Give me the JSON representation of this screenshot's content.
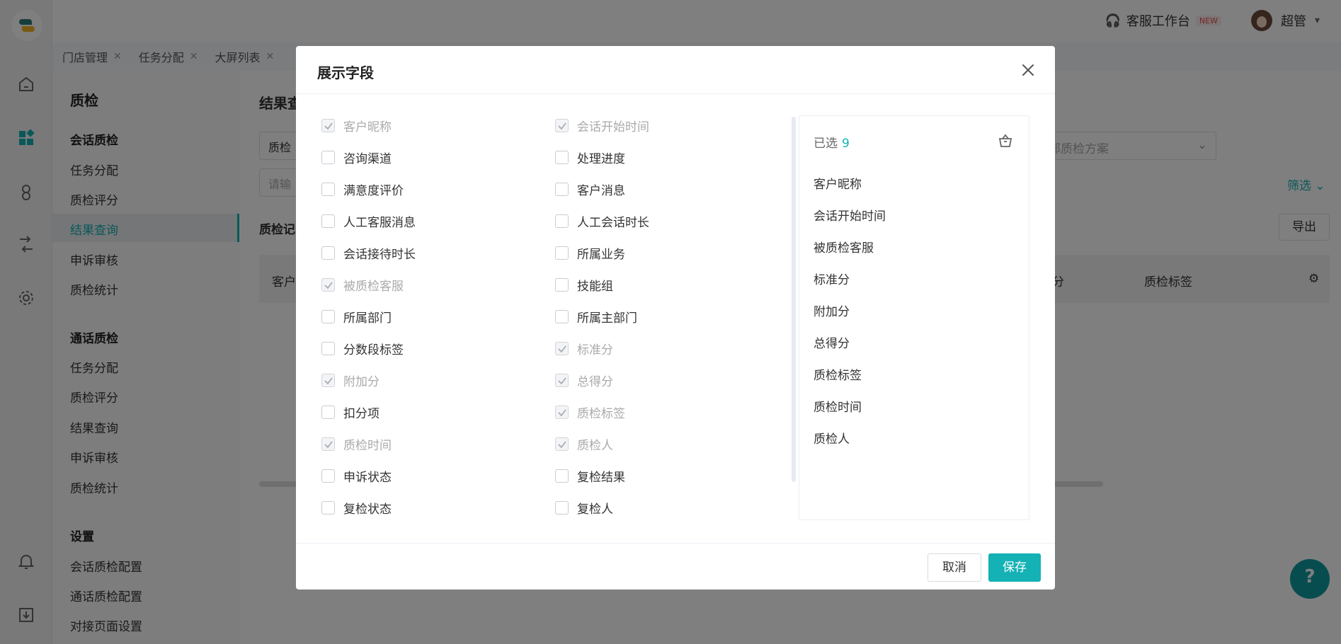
{
  "topbar": {
    "workspace_label": "客服工作台",
    "workspace_badge": "NEW",
    "user_name": "超管"
  },
  "tabs": [
    {
      "label": "门店管理"
    },
    {
      "label": "任务分配"
    },
    {
      "label": "大屏列表"
    }
  ],
  "sidenav": {
    "title": "质检",
    "groups": [
      {
        "heading": "会话质检",
        "items": [
          "任务分配",
          "质检评分",
          "结果查询",
          "申诉审核",
          "质检统计"
        ]
      },
      {
        "heading": "通话质检",
        "items": [
          "任务分配",
          "质检评分",
          "结果查询",
          "申诉审核",
          "质检统计"
        ]
      },
      {
        "heading": "设置",
        "items": [
          "会话质检配置",
          "通话质检配置",
          "对接页面设置"
        ]
      }
    ],
    "active_item": "结果查询"
  },
  "main": {
    "title": "结果查",
    "select_value": "质检",
    "input_placeholder": "请输",
    "scheme_placeholder": "部质检方案",
    "filter_label": "筛选",
    "section_title": "质检记",
    "export_label": "导出",
    "table_headers": [
      "客户",
      "分",
      "质检标签"
    ]
  },
  "modal": {
    "title": "展示字段",
    "fields": [
      {
        "label": "客户昵称",
        "checked": true,
        "locked": true
      },
      {
        "label": "会话开始时间",
        "checked": true,
        "locked": true
      },
      {
        "label": "咨询渠道",
        "checked": false,
        "locked": false
      },
      {
        "label": "处理进度",
        "checked": false,
        "locked": false
      },
      {
        "label": "满意度评价",
        "checked": false,
        "locked": false
      },
      {
        "label": "客户消息",
        "checked": false,
        "locked": false
      },
      {
        "label": "人工客服消息",
        "checked": false,
        "locked": false
      },
      {
        "label": "人工会话时长",
        "checked": false,
        "locked": false
      },
      {
        "label": "会话接待时长",
        "checked": false,
        "locked": false
      },
      {
        "label": "所属业务",
        "checked": false,
        "locked": false
      },
      {
        "label": "被质检客服",
        "checked": true,
        "locked": true
      },
      {
        "label": "技能组",
        "checked": false,
        "locked": false
      },
      {
        "label": "所属部门",
        "checked": false,
        "locked": false
      },
      {
        "label": "所属主部门",
        "checked": false,
        "locked": false
      },
      {
        "label": "分数段标签",
        "checked": false,
        "locked": false
      },
      {
        "label": "标准分",
        "checked": true,
        "locked": true
      },
      {
        "label": "附加分",
        "checked": true,
        "locked": true
      },
      {
        "label": "总得分",
        "checked": true,
        "locked": true
      },
      {
        "label": "扣分项",
        "checked": false,
        "locked": false
      },
      {
        "label": "质检标签",
        "checked": true,
        "locked": true
      },
      {
        "label": "质检时间",
        "checked": true,
        "locked": true
      },
      {
        "label": "质检人",
        "checked": true,
        "locked": true
      },
      {
        "label": "申诉状态",
        "checked": false,
        "locked": false
      },
      {
        "label": "复检结果",
        "checked": false,
        "locked": false
      },
      {
        "label": "复检状态",
        "checked": false,
        "locked": false
      },
      {
        "label": "复检人",
        "checked": false,
        "locked": false
      }
    ],
    "selected": {
      "label": "已选",
      "count": "9",
      "items": [
        "客户昵称",
        "会话开始时间",
        "被质检客服",
        "标准分",
        "附加分",
        "总得分",
        "质检标签",
        "质检时间",
        "质检人"
      ]
    },
    "cancel_label": "取消",
    "save_label": "保存"
  },
  "colors": {
    "accent": "#14b1b5",
    "overlay": "rgba(0,0,0,0.5)"
  }
}
